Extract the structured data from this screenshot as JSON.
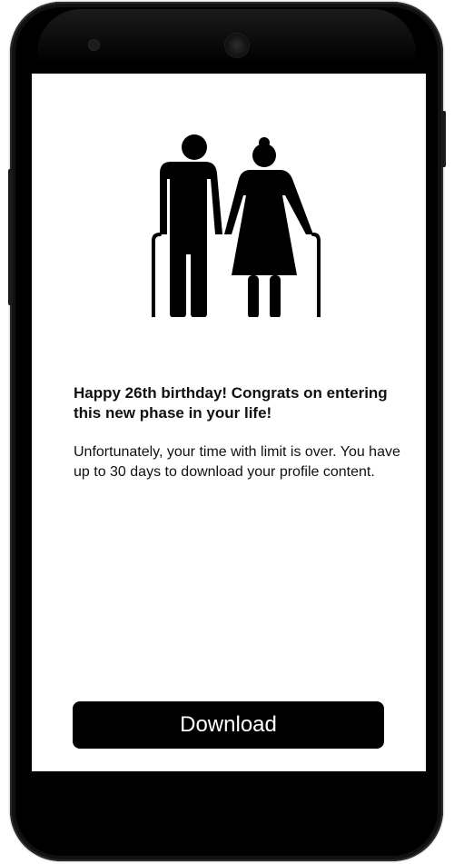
{
  "message": {
    "headline": "Happy 26th birthday! Congrats on entering this new phase in your life!",
    "body": "Unfortunately, your time with limit is over. You have up to 30 days to download your profile content."
  },
  "actions": {
    "download_label": "Download"
  },
  "illustration": {
    "icon": "elderly-couple-icon"
  },
  "colors": {
    "button_bg": "#000000",
    "button_text": "#ffffff",
    "screen_bg": "#ffffff",
    "text": "#111111",
    "device_frame": "#000000"
  }
}
